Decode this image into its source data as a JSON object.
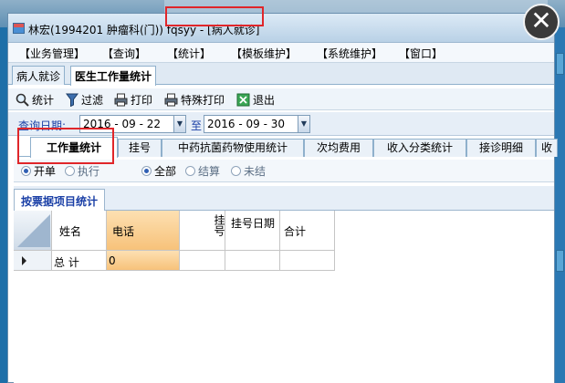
{
  "window": {
    "title": "林宏(1994201 肿瘤科(门)) fqsyy - [病人就诊]"
  },
  "close_button": "✕",
  "menu": [
    "【业务管理】",
    "【查询】",
    "【统计】",
    "【模板维护】",
    "【系统维护】",
    "【窗口】"
  ],
  "doc_tabs": [
    "病人就诊",
    "医生工作量统计"
  ],
  "toolbar": {
    "stat_label": "统计",
    "filter_label": "过滤",
    "print_label": "打印",
    "special_print_label": "特殊打印",
    "exit_label": "退出"
  },
  "query": {
    "label": "查询日期:",
    "from_date": "2016 - 09 - 22",
    "to_label": "至",
    "to_date": "2016 - 09 - 30"
  },
  "stat_tabs": [
    "工作量统计",
    "挂号",
    "中药抗菌药物使用统计",
    "次均费用",
    "收入分类统计",
    "接诊明细",
    "收"
  ],
  "radios": {
    "group1": [
      {
        "label": "开单",
        "checked": true
      },
      {
        "label": "执行",
        "checked": false
      }
    ],
    "group2": [
      {
        "label": "全部",
        "checked": true
      },
      {
        "label": "结算",
        "checked": false
      },
      {
        "label": "未结",
        "checked": false
      }
    ]
  },
  "subtab_label": "按票据项目统计",
  "table": {
    "columns": [
      "姓名",
      "电话",
      "挂号",
      "挂号日期",
      "合计"
    ],
    "rows": [
      {
        "name": "总 计",
        "phone": "0",
        "guahao": "",
        "guahao_date": "",
        "total": ""
      }
    ]
  },
  "colors": {
    "annotation_red": "#e0262a",
    "highlight": "#f7c27a",
    "accent_blue": "#1a3fa6"
  }
}
